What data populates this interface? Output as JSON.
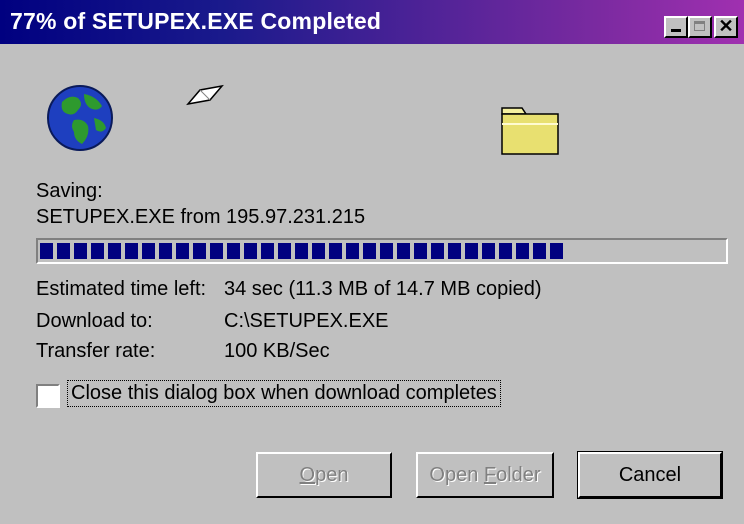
{
  "window": {
    "title": "77% of SETUPEX.EXE Completed"
  },
  "icons": {
    "globe": "globe-icon",
    "paper": "flying-paper-icon",
    "folder": "folder-icon"
  },
  "status": {
    "saving_label": "Saving:",
    "file_line": "SETUPEX.EXE from 195.97.231.215",
    "progress_percent": 77
  },
  "details": {
    "time_left_label": "Estimated time left:",
    "time_left_value": "34 sec (11.3 MB of 14.7 MB copied)",
    "download_to_label": "Download to:",
    "download_to_value": "C:\\SETUPEX.EXE",
    "transfer_rate_label": "Transfer rate:",
    "transfer_rate_value": "100 KB/Sec"
  },
  "checkbox": {
    "label": "Close this dialog box when download completes",
    "checked": false
  },
  "buttons": {
    "open_pre": "",
    "open_u": "O",
    "open_post": "pen",
    "openfolder_pre": "Open ",
    "openfolder_u": "F",
    "openfolder_post": "older",
    "cancel": "Cancel"
  },
  "colors": {
    "progress_fill": "#000080",
    "face": "#c0c0c0"
  }
}
